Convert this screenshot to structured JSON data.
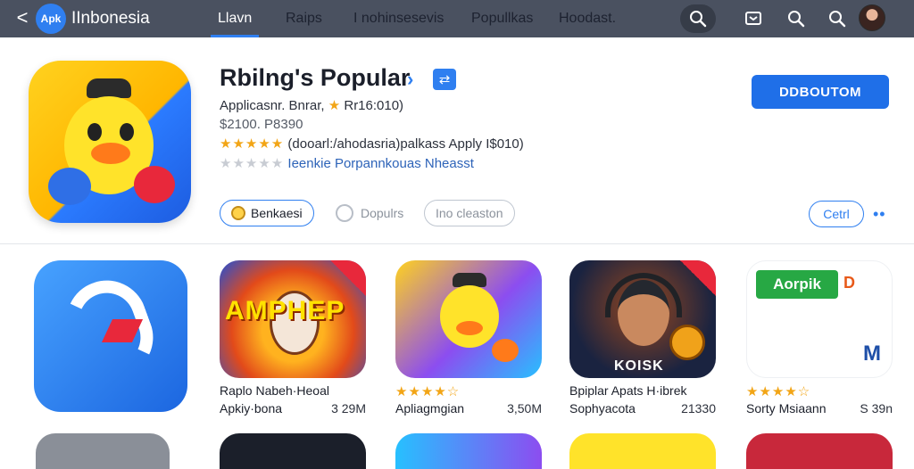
{
  "topbar": {
    "back": "<",
    "logo": "Apk",
    "app_name": "IInbonesia",
    "tabs": [
      {
        "label": "Llavn",
        "active": true
      },
      {
        "label": "Raips"
      },
      {
        "label": "I nohinsesevis"
      },
      {
        "label": "Popullkas"
      },
      {
        "label": "Hoodast."
      }
    ],
    "icons": [
      "search-icon",
      "gamepad-icon",
      "search-icon",
      "search-icon"
    ]
  },
  "featured": {
    "title": "Rbilng's Popular",
    "chevron": "›",
    "share": "⇄",
    "meta": "Applicasnr. Bnrar, ",
    "meta_star": "★",
    "meta_rating": " Rr16:010)",
    "price": "$2100. P8390",
    "stars": "★★★★★",
    "rating_text": " (dooarl:/ahodasria)palkass Apply I$010)",
    "stars2": "★★★★★",
    "rating_text2": " Ieenkie Porpannkouas Nheasst",
    "chips": [
      "Benkaesi",
      "Dopulrs",
      "Ino cleaston"
    ],
    "download": "DDBOUTOM",
    "cetl": "Cetrl",
    "more": "••"
  },
  "apps": [
    {
      "name": "Raplo Nabeh·Heoal",
      "sub": "Apkiy·bona",
      "size": "3 29M"
    },
    {
      "stars": "★★★★☆",
      "name": "",
      "sub": "Apliagmgian",
      "size": "3,50M"
    },
    {
      "name": "Bpiplar Apats H·ibrek",
      "sub": "Sophyacota",
      "size": "21330"
    },
    {
      "stars": "★★★★☆",
      "name": "",
      "sub": "Sorty Msiaann",
      "size": "S 39n"
    }
  ],
  "app_tiles": {
    "amp_text": "AMPHEP",
    "hero_text": "KOISK",
    "green_text": "Aorpik",
    "green_tag": "D",
    "mark": "M"
  },
  "colors": {
    "nav_bg": "#4a5160",
    "accent": "#2f7ff0",
    "star": "#f2a516"
  }
}
